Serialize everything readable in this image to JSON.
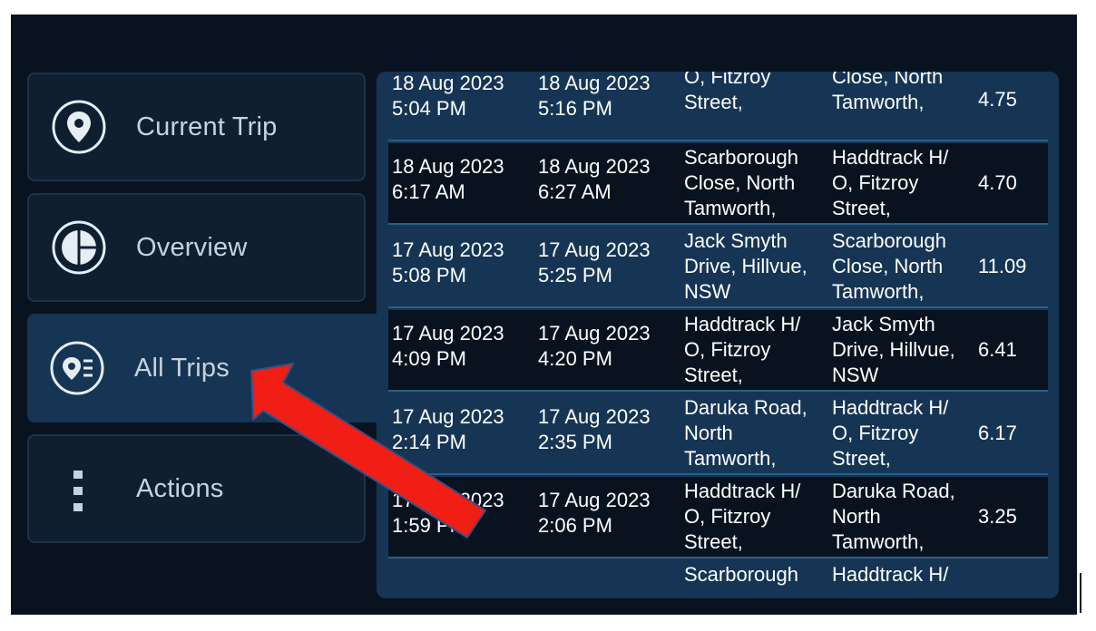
{
  "sidebar": {
    "items": [
      {
        "label": "Current Trip",
        "icon": "location-pin-icon",
        "active": false
      },
      {
        "label": "Overview",
        "icon": "pie-chart-icon",
        "active": false
      },
      {
        "label": "All Trips",
        "icon": "pin-list-icon",
        "active": true
      },
      {
        "label": "Actions",
        "icon": "more-vertical-icon",
        "active": false
      }
    ]
  },
  "trips": [
    {
      "start": "18 Aug 2023\n5:04 PM",
      "end": "18 Aug 2023\n5:16 PM",
      "from": "Haddtrack H/\nO, Fitzroy\nStreet,\nTamworth,",
      "to": "Scarborough\nClose, North\nTamworth,\nNSW",
      "distance": "4.75"
    },
    {
      "start": "18 Aug 2023\n6:17 AM",
      "end": "18 Aug 2023\n6:27 AM",
      "from": "Scarborough\nClose, North\nTamworth,\nNSW",
      "to": "Haddtrack H/\nO, Fitzroy\nStreet,\nTamworth,",
      "distance": "4.70"
    },
    {
      "start": "17 Aug 2023\n5:08 PM",
      "end": "17 Aug 2023\n5:25 PM",
      "from": "Jack Smyth\nDrive, Hillvue,\nNSW",
      "to": "Scarborough\nClose, North\nTamworth,\nNSW",
      "distance": "11.09"
    },
    {
      "start": "17 Aug 2023\n4:09 PM",
      "end": "17 Aug 2023\n4:20 PM",
      "from": "Haddtrack H/\nO, Fitzroy\nStreet,\nTamworth,",
      "to": "Jack Smyth\nDrive, Hillvue,\nNSW",
      "distance": "6.41"
    },
    {
      "start": "17 Aug 2023\n2:14 PM",
      "end": "17 Aug 2023\n2:35 PM",
      "from": "Daruka Road,\nNorth\nTamworth,\nNSW",
      "to": "Haddtrack H/\nO, Fitzroy\nStreet,\nTamworth,",
      "distance": "6.17"
    },
    {
      "start": "17 Aug 2023\n1:59 PM",
      "end": "17 Aug 2023\n2:06 PM",
      "from": "Haddtrack H/\nO, Fitzroy\nStreet,\nTamworth,",
      "to": "Daruka Road,\nNorth\nTamworth,\nNSW",
      "distance": "3.25"
    },
    {
      "start": "",
      "end": "",
      "from": "Scarborough",
      "to": "Haddtrack H/",
      "distance": ""
    }
  ],
  "colors": {
    "background": "#08131f",
    "panel": "#163554",
    "annotation_arrow": "#f01e14"
  }
}
